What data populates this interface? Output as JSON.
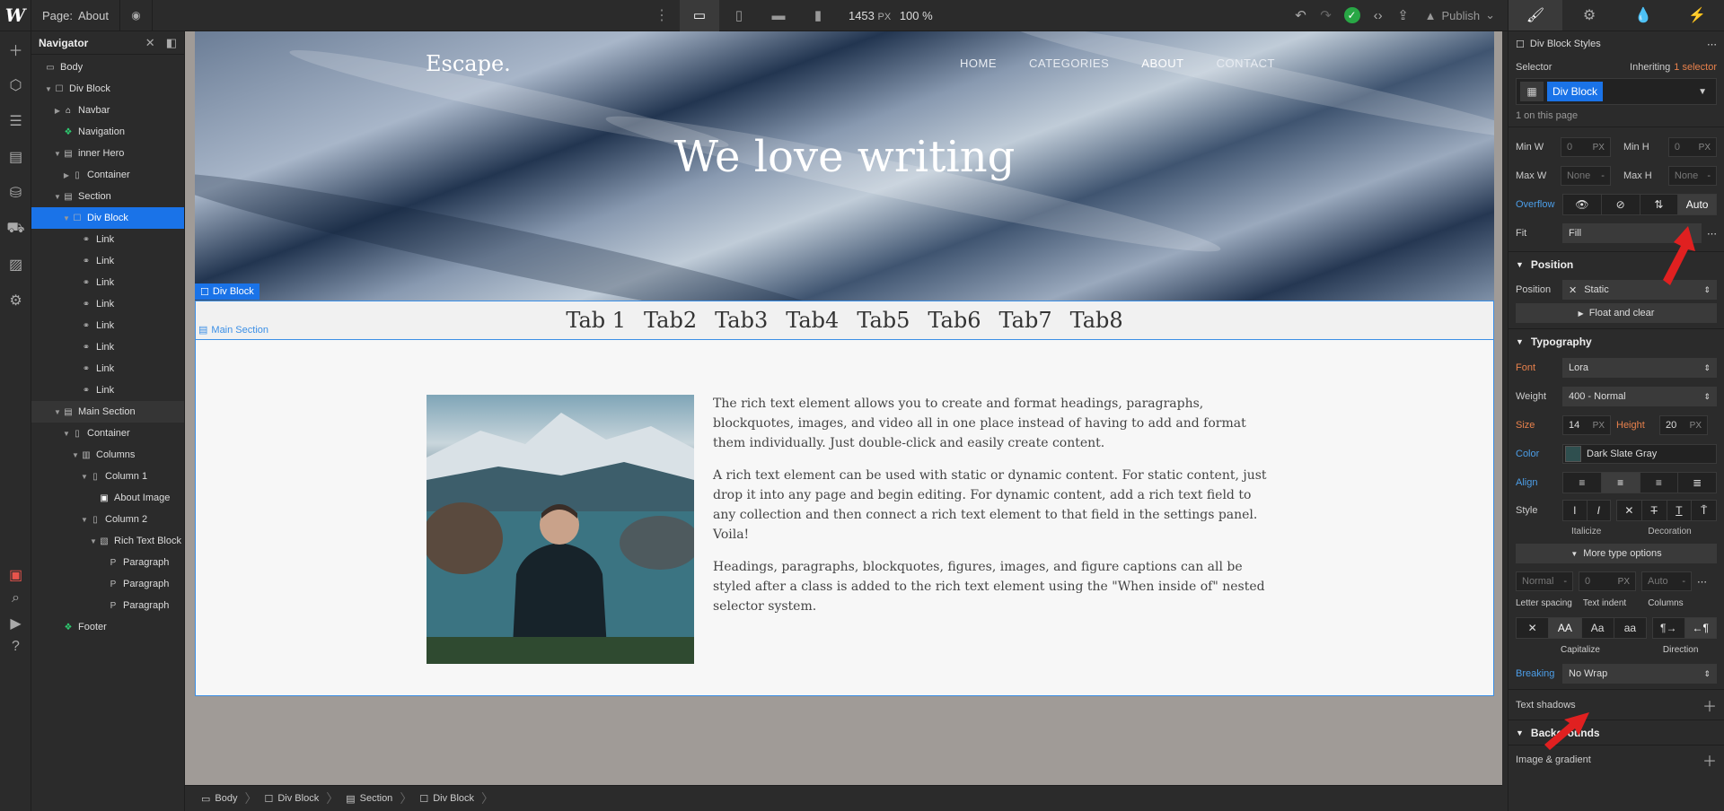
{
  "topbar": {
    "logo": "W",
    "page_label": "Page:",
    "page_name": "About",
    "width": "1453",
    "width_unit": "PX",
    "zoom": "100 %",
    "publish": "Publish"
  },
  "navigator": {
    "title": "Navigator",
    "items": [
      {
        "label": "Body",
        "depth": 0,
        "icon": "▭",
        "caret": ""
      },
      {
        "label": "Div Block",
        "depth": 1,
        "icon": "☐",
        "caret": "▼"
      },
      {
        "label": "Navbar",
        "depth": 2,
        "icon": "⌂",
        "caret": "▶"
      },
      {
        "label": "Navigation",
        "depth": 2,
        "icon": "❖",
        "caret": ""
      },
      {
        "label": "inner Hero",
        "depth": 2,
        "icon": "▤",
        "caret": "▼"
      },
      {
        "label": "Container",
        "depth": 3,
        "icon": "▯",
        "caret": "▶"
      },
      {
        "label": "Section",
        "depth": 2,
        "icon": "▤",
        "caret": "▼"
      },
      {
        "label": "Div Block",
        "depth": 3,
        "icon": "☐",
        "caret": "▼"
      },
      {
        "label": "Link",
        "depth": 4,
        "icon": "⚭",
        "caret": ""
      },
      {
        "label": "Link",
        "depth": 4,
        "icon": "⚭",
        "caret": ""
      },
      {
        "label": "Link",
        "depth": 4,
        "icon": "⚭",
        "caret": ""
      },
      {
        "label": "Link",
        "depth": 4,
        "icon": "⚭",
        "caret": ""
      },
      {
        "label": "Link",
        "depth": 4,
        "icon": "⚭",
        "caret": ""
      },
      {
        "label": "Link",
        "depth": 4,
        "icon": "⚭",
        "caret": ""
      },
      {
        "label": "Link",
        "depth": 4,
        "icon": "⚭",
        "caret": ""
      },
      {
        "label": "Link",
        "depth": 4,
        "icon": "⚭",
        "caret": ""
      },
      {
        "label": "Main Section",
        "depth": 2,
        "icon": "▤",
        "caret": "▼"
      },
      {
        "label": "Container",
        "depth": 3,
        "icon": "▯",
        "caret": "▼"
      },
      {
        "label": "Columns",
        "depth": 4,
        "icon": "▥",
        "caret": "▼"
      },
      {
        "label": "Column 1",
        "depth": 5,
        "icon": "▯",
        "caret": "▼"
      },
      {
        "label": "About Image",
        "depth": 6,
        "icon": "▣",
        "caret": ""
      },
      {
        "label": "Column 2",
        "depth": 5,
        "icon": "▯",
        "caret": "▼"
      },
      {
        "label": "Rich Text Block",
        "depth": 6,
        "icon": "▧",
        "caret": "▼"
      },
      {
        "label": "Paragraph",
        "depth": 7,
        "icon": "P",
        "caret": ""
      },
      {
        "label": "Paragraph",
        "depth": 7,
        "icon": "P",
        "caret": ""
      },
      {
        "label": "Paragraph",
        "depth": 7,
        "icon": "P",
        "caret": ""
      },
      {
        "label": "Footer",
        "depth": 2,
        "icon": "❖",
        "caret": ""
      }
    ]
  },
  "site": {
    "brand": "Escape.",
    "nav": [
      "HOME",
      "CATEGORIES",
      "ABOUT",
      "CONTACT"
    ],
    "hero_title": "We love writing",
    "tabs": [
      "Tab 1",
      "Tab2",
      "Tab3",
      "Tab4",
      "Tab5",
      "Tab6",
      "Tab7",
      "Tab8"
    ],
    "selected_label": "Div Block",
    "main_section_label": "Main Section",
    "paragraphs": [
      "The rich text element allows you to create and format headings, paragraphs, blockquotes, images, and video all in one place instead of having to add and format them individually. Just double-click and easily create content.",
      "A rich text element can be used with static or dynamic content. For static content, just drop it into any page and begin editing. For dynamic content, add a rich text field to any collection and then connect a rich text element to that field in the settings panel. Voila!",
      "Headings, paragraphs, blockquotes, figures, images, and figure captions can all be styled after a class is added to the rich text element using the \"When inside of\" nested selector system."
    ]
  },
  "breadcrumb": [
    "Body",
    "Div Block",
    "Section",
    "Div Block"
  ],
  "style_panel": {
    "title": "Div Block Styles",
    "selector_label": "Selector",
    "inheriting_label": "Inheriting",
    "inheriting_count": "1 selector",
    "selector_chip": "Div Block",
    "on_page": "1 on this page",
    "min_w_label": "Min W",
    "min_w": "0",
    "min_h_label": "Min H",
    "min_h": "0",
    "max_w_label": "Max W",
    "max_w": "None",
    "max_h_label": "Max H",
    "max_h": "None",
    "unit": "PX",
    "overflow_label": "Overflow",
    "overflow_auto": "Auto",
    "fit_label": "Fit",
    "fit_value": "Fill",
    "position_head": "Position",
    "position_label": "Position",
    "position_value": "Static",
    "float_clear": "Float and clear",
    "typography_head": "Typography",
    "font_label": "Font",
    "font_value": "Lora",
    "weight_label": "Weight",
    "weight_value": "400 - Normal",
    "size_label": "Size",
    "size_value": "14",
    "height_label": "Height",
    "height_value": "20",
    "color_label": "Color",
    "color_value": "Dark Slate Gray",
    "align_label": "Align",
    "style_label": "Style",
    "italicize": "Italicize",
    "decoration": "Decoration",
    "more_type": "More type options",
    "letter_spacing_value": "Normal",
    "text_indent_value": "0",
    "columns_value": "Auto",
    "letter_spacing": "Letter spacing",
    "text_indent": "Text indent",
    "columns": "Columns",
    "capitalize": "Capitalize",
    "direction": "Direction",
    "breaking_label": "Breaking",
    "breaking_value": "No Wrap",
    "text_shadow": "Text shadows",
    "backgrounds_head": "Backgrounds",
    "image_gradient": "Image & gradient",
    "caps_options": [
      "✕",
      "AA",
      "Aa",
      "aa"
    ]
  },
  "colors": {
    "accent": "#1a73e8",
    "panel": "#2b2b2b",
    "check": "#28a745",
    "annotation_arrow": "#e02020"
  }
}
